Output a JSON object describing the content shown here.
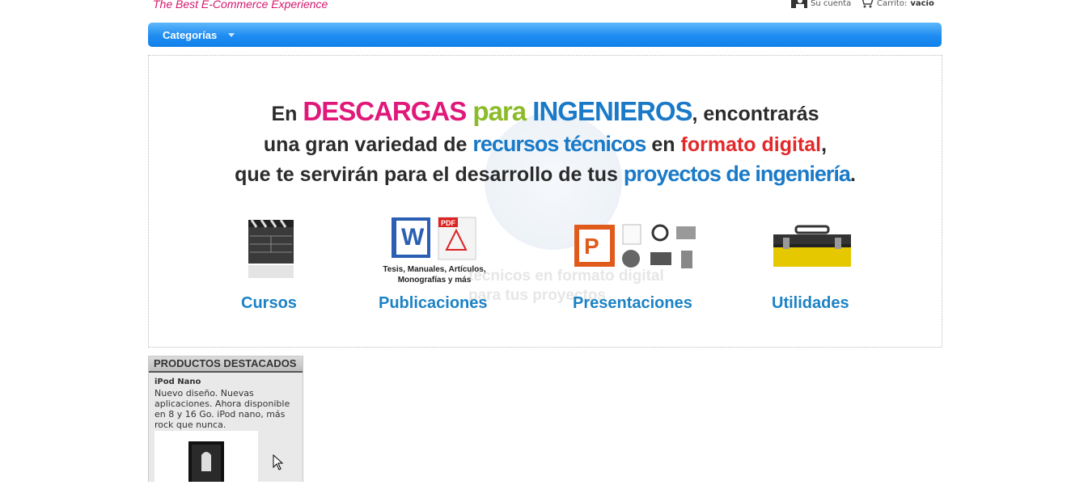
{
  "header": {
    "tagline": "The Best E-Commerce Experience",
    "account_label": "Su cuenta",
    "cart_label": "Carrito:",
    "cart_value": "vacío"
  },
  "nav": {
    "categories_label": "Categorías"
  },
  "banner": {
    "line1": {
      "a": "En ",
      "b": "DESCARGAS",
      "c": " para",
      "d": " INGENIEROS",
      "e": ", encontrarás"
    },
    "line2": {
      "a": "una gran variedad de ",
      "b": "recursos técnicos",
      "c": " en ",
      "d": "formato digital",
      "e": ","
    },
    "line3": {
      "a": "que te servirán para el desarrollo de tus ",
      "b": "proyectos de ingeniería",
      "c": "."
    },
    "ghost_text_1": "técnicos en formato digital",
    "ghost_text_2": "para tus proyectos",
    "categories": [
      {
        "label": "Cursos",
        "icon": "clapperboard-icon"
      },
      {
        "label": "Publicaciones",
        "icon": "documents-icon",
        "sub": "Tesis, Manuales, Artículos, Monografías y más"
      },
      {
        "label": "Presentaciones",
        "icon": "presentation-media-icon"
      },
      {
        "label": "Utilidades",
        "icon": "toolbox-icon"
      }
    ]
  },
  "featured": {
    "heading": "PRODUCTOS DESTACADOS",
    "product_name": "iPod Nano",
    "product_desc": "Nuevo diseño. Nuevas aplicaciones. Ahora disponible en 8 y 16 Go. iPod nano, más rock que nunca."
  },
  "colors": {
    "nav": "#1e8cf1",
    "accent_pink": "#e0187a",
    "link_blue": "#1b82c6"
  }
}
